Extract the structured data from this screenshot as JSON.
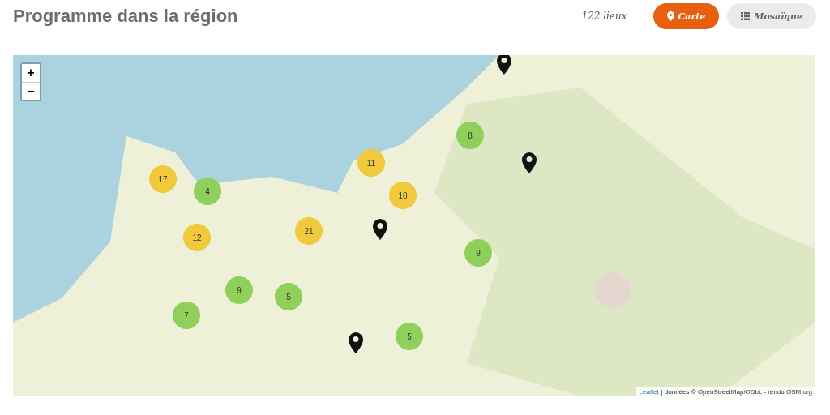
{
  "title": "Programme dans la région",
  "count": "122 lieux",
  "views": [
    {
      "label": "Carte",
      "kind": "map",
      "selected": true
    },
    {
      "label": "Mosaïque",
      "kind": "mosaic",
      "selected": false
    }
  ],
  "map": {
    "zoom_in": "+",
    "zoom_out": "−",
    "clusters": [
      {
        "count": "17",
        "color": "#f0c93c"
      },
      {
        "count": "4",
        "color": "#8fd05a"
      },
      {
        "count": "12",
        "color": "#f0c93c"
      },
      {
        "count": "21",
        "color": "#f0c93c"
      },
      {
        "count": "11",
        "color": "#f0c93c"
      },
      {
        "count": "10",
        "color": "#f0c93c"
      },
      {
        "count": "8",
        "color": "#8fd05a"
      },
      {
        "count": "9",
        "color": "#8fd05a"
      },
      {
        "count": "9",
        "color": "#8fd05a"
      },
      {
        "count": "5",
        "color": "#8fd05a"
      },
      {
        "count": "7",
        "color": "#8fd05a"
      },
      {
        "count": "5",
        "color": "#8fd05a"
      }
    ],
    "attribution": {
      "link": "Leaflet",
      "text": "| données © OpenStreetMap/ODbL - rendu OSM org"
    }
  }
}
